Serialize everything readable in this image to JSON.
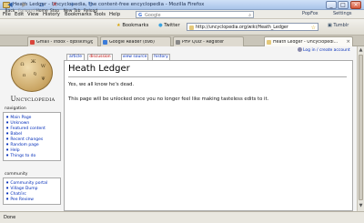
{
  "window": {
    "title": "Heath Ledger - Uncyclopedia, the content-free encyclopedia - Mozilla Firefox",
    "minimize": "_",
    "maximize": "□",
    "close": "×"
  },
  "menu": {
    "items": [
      "File",
      "Edit",
      "View",
      "History",
      "Bookmarks",
      "Tools",
      "Help"
    ],
    "search_engine": "G",
    "search_placeholder": "Google",
    "search_icon": "⌕",
    "popular_label": "PopFox",
    "settings_label": "Settings"
  },
  "toolbar": {
    "buttons": [
      {
        "label": "Back",
        "icon": "◀"
      },
      {
        "label": "Forward",
        "icon": "▶"
      },
      {
        "label": "Home",
        "icon": "⌂"
      },
      {
        "label": "Stop",
        "icon": "✕"
      },
      {
        "label": "New Tab",
        "icon": "+"
      },
      {
        "label": "Reload",
        "icon": "↻"
      }
    ],
    "bookmarks_label": "Bookmarks",
    "twitter_label": "Twitter",
    "url": "http://uncyclopedia.org/wiki/Heath_Ledger",
    "tumblr_label": "Tumblr"
  },
  "tabs": [
    {
      "label": "Gmail - Inbox - djbiskin@gma...",
      "color": "#d9443a",
      "active": false
    },
    {
      "label": "Google Reader (898)",
      "color": "#3b7bd9",
      "active": false
    },
    {
      "label": "PHP Quiz - Register",
      "color": "#888888",
      "active": false
    },
    {
      "label": "Heath Ledger - Uncyclopedi...",
      "color": "#e4c87a",
      "active": true
    }
  ],
  "page": {
    "logo_text": "Uncyclopedia",
    "logo_glyphs": [
      "Ω",
      "Ж",
      "W",
      "π",
      "ŋ",
      "Ψ"
    ],
    "tabs": [
      "article",
      "discussion",
      "view source",
      "history"
    ],
    "personal": "Log in / create account",
    "heading": "Heath Ledger",
    "paragraph1": "Yes, we all know he's dead.",
    "paragraph2": "This page will be unlocked once you no longer feel like making tasteless edits to it.",
    "nav_title": "navigation",
    "nav_items": [
      "Main Page",
      "Unknown",
      "Featured content",
      "Babel",
      "Recent changes",
      "Random page",
      "Help",
      "Things to do"
    ],
    "community_title": "community",
    "community_items": [
      "Community portal",
      "Village Dump",
      "Chat/irc",
      "Pee Review"
    ]
  },
  "status": {
    "text": "Done"
  }
}
